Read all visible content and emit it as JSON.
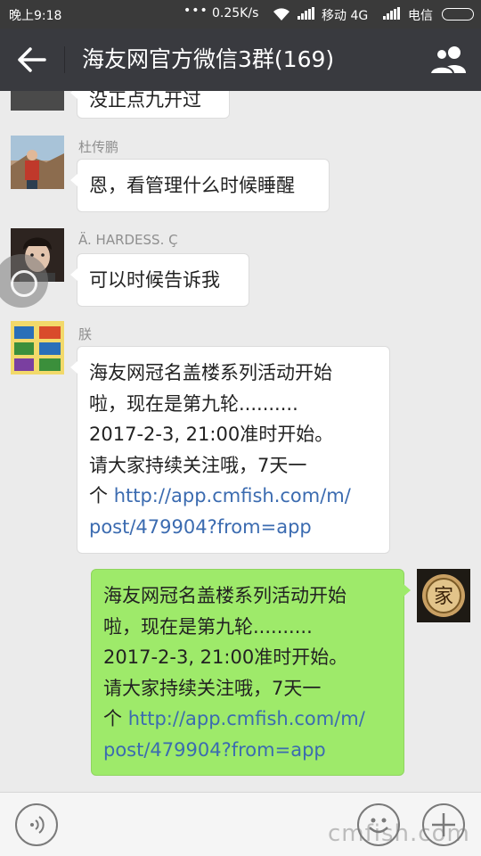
{
  "status_bar": {
    "time": "晚上9:18",
    "dots": "•••",
    "net_speed": "0.25K/s",
    "carrier1": "移动 4G",
    "carrier2": "电信"
  },
  "header": {
    "title": "海友网官方微信3群(169)"
  },
  "messages": [
    {
      "sender": "",
      "text": "没正点九开过"
    },
    {
      "sender": "杜传鹏",
      "text": "恩，看管理什么时候睡醒"
    },
    {
      "sender": "Ä. HARDESS. Ç",
      "text": "可以时候告诉我"
    },
    {
      "sender": "朕",
      "lines": [
        "海友网冠名盖楼系列活动开始",
        "啦，现在是第九轮..........",
        "2017-2-3, 21:00准时开始。",
        "请大家持续关注哦，7天一"
      ],
      "line5_prefix": "个 ",
      "link_part1": "http://app.cmfish.com/m/",
      "link_part2": "post/479904?from=app"
    },
    {
      "sender": "self",
      "lines": [
        "海友网冠名盖楼系列活动开始",
        "啦，现在是第九轮..........",
        "2017-2-3, 21:00准时开始。",
        "请大家持续关注哦，7天一"
      ],
      "line5_prefix": "个 ",
      "link_part1": "http://app.cmfish.com/m/",
      "link_part2": "post/479904?from=app"
    }
  ],
  "self_avatar_char": "家",
  "watermark": "cmfish.com",
  "colors": {
    "header_bg": "#393a3f",
    "chat_bg": "#ebebeb",
    "green_bubble": "#9eea6a",
    "link": "#3b6bb0"
  },
  "icons": [
    "back-arrow-icon",
    "group-members-icon",
    "voice-icon",
    "emoji-icon",
    "plus-icon"
  ]
}
